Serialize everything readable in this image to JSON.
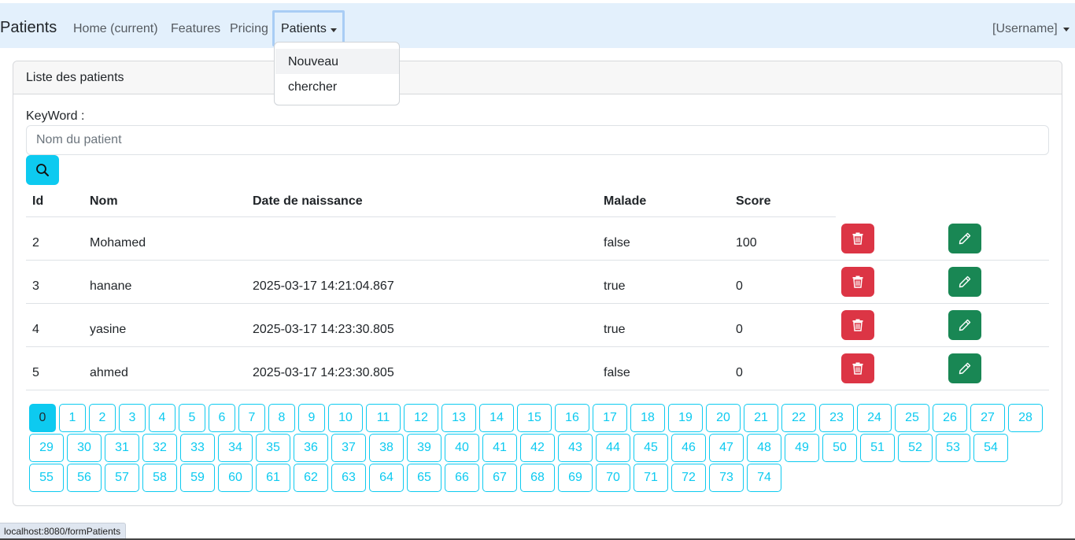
{
  "navbar": {
    "brand": "Patients",
    "links": [
      "Home (current)",
      "Features",
      "Pricing"
    ],
    "dropdown_label": "Patients",
    "user": "[Username]"
  },
  "dropdown_menu": {
    "items": [
      "Nouveau",
      "chercher"
    ]
  },
  "card": {
    "header": "Liste des patients",
    "keyword_label": "KeyWord :",
    "search_placeholder": "Nom du patient"
  },
  "table": {
    "headers": [
      "Id",
      "Nom",
      "Date de naissance",
      "Malade",
      "Score"
    ],
    "rows": [
      {
        "id": "2",
        "nom": "Mohamed",
        "date": "",
        "malade": "false",
        "score": "100"
      },
      {
        "id": "3",
        "nom": "hanane",
        "date": "2025-03-17 14:21:04.867",
        "malade": "true",
        "score": "0"
      },
      {
        "id": "4",
        "nom": "yasine",
        "date": "2025-03-17 14:23:30.805",
        "malade": "true",
        "score": "0"
      },
      {
        "id": "5",
        "nom": "ahmed",
        "date": "2025-03-17 14:23:30.805",
        "malade": "false",
        "score": "0"
      }
    ]
  },
  "pagination": {
    "current": 0,
    "pages": [
      "0",
      "1",
      "2",
      "3",
      "4",
      "5",
      "6",
      "7",
      "8",
      "9",
      "10",
      "11",
      "12",
      "13",
      "14",
      "15",
      "16",
      "17",
      "18",
      "19",
      "20",
      "21",
      "22",
      "23",
      "24",
      "25",
      "26",
      "27",
      "28",
      "29",
      "30",
      "31",
      "32",
      "33",
      "34",
      "35",
      "36",
      "37",
      "38",
      "39",
      "40",
      "41",
      "42",
      "43",
      "44",
      "45",
      "46",
      "47",
      "48",
      "49",
      "50",
      "51",
      "52",
      "53",
      "54",
      "55",
      "56",
      "57",
      "58",
      "59",
      "60",
      "61",
      "62",
      "63",
      "64",
      "65",
      "66",
      "67",
      "68",
      "69",
      "70",
      "71",
      "72",
      "73",
      "74"
    ]
  },
  "status_bar": "localhost:8080/formPatients",
  "colors": {
    "navbar_bg": "#e3f0fc",
    "info": "#0dcaf0",
    "danger": "#dc3545",
    "success": "#198754"
  }
}
